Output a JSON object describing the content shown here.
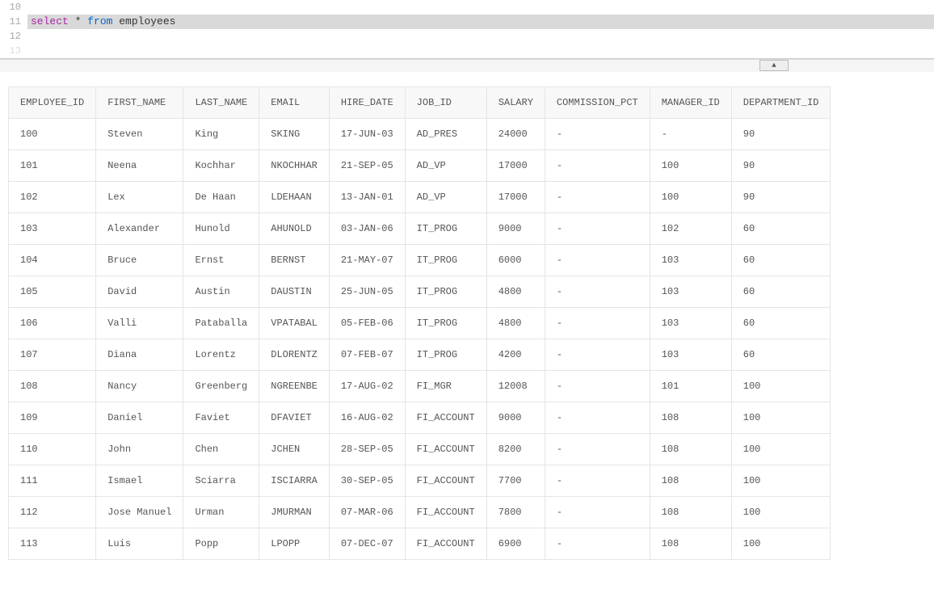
{
  "editor": {
    "lines": [
      {
        "num": "10",
        "tokens": []
      },
      {
        "num": "11",
        "tokens": [
          {
            "cls": "kw1",
            "text": "select"
          },
          {
            "cls": "",
            "text": " * "
          },
          {
            "cls": "kw2",
            "text": "from"
          },
          {
            "cls": "",
            "text": " "
          },
          {
            "cls": "ident",
            "text": "employees"
          }
        ],
        "active": true
      },
      {
        "num": "12",
        "tokens": [],
        "cursor": true
      },
      {
        "num": "13",
        "faded": true,
        "tokens": []
      }
    ],
    "scroll_arrow": "▲"
  },
  "results": {
    "columns": [
      "EMPLOYEE_ID",
      "FIRST_NAME",
      "LAST_NAME",
      "EMAIL",
      "HIRE_DATE",
      "JOB_ID",
      "SALARY",
      "COMMISSION_PCT",
      "MANAGER_ID",
      "DEPARTMENT_ID"
    ],
    "rows": [
      [
        "100",
        "Steven",
        "King",
        "SKING",
        "17-JUN-03",
        "AD_PRES",
        "24000",
        " - ",
        " - ",
        "90"
      ],
      [
        "101",
        "Neena",
        "Kochhar",
        "NKOCHHAR",
        "21-SEP-05",
        "AD_VP",
        "17000",
        " - ",
        "100",
        "90"
      ],
      [
        "102",
        "Lex",
        "De Haan",
        "LDEHAAN",
        "13-JAN-01",
        "AD_VP",
        "17000",
        " - ",
        "100",
        "90"
      ],
      [
        "103",
        "Alexander",
        "Hunold",
        "AHUNOLD",
        "03-JAN-06",
        "IT_PROG",
        "9000",
        " - ",
        "102",
        "60"
      ],
      [
        "104",
        "Bruce",
        "Ernst",
        "BERNST",
        "21-MAY-07",
        "IT_PROG",
        "6000",
        " - ",
        "103",
        "60"
      ],
      [
        "105",
        "David",
        "Austin",
        "DAUSTIN",
        "25-JUN-05",
        "IT_PROG",
        "4800",
        " - ",
        "103",
        "60"
      ],
      [
        "106",
        "Valli",
        "Pataballa",
        "VPATABAL",
        "05-FEB-06",
        "IT_PROG",
        "4800",
        " - ",
        "103",
        "60"
      ],
      [
        "107",
        "Diana",
        "Lorentz",
        "DLORENTZ",
        "07-FEB-07",
        "IT_PROG",
        "4200",
        " - ",
        "103",
        "60"
      ],
      [
        "108",
        "Nancy",
        "Greenberg",
        "NGREENBE",
        "17-AUG-02",
        "FI_MGR",
        "12008",
        " - ",
        "101",
        "100"
      ],
      [
        "109",
        "Daniel",
        "Faviet",
        "DFAVIET",
        "16-AUG-02",
        "FI_ACCOUNT",
        "9000",
        " - ",
        "108",
        "100"
      ],
      [
        "110",
        "John",
        "Chen",
        "JCHEN",
        "28-SEP-05",
        "FI_ACCOUNT",
        "8200",
        " - ",
        "108",
        "100"
      ],
      [
        "111",
        "Ismael",
        "Sciarra",
        "ISCIARRA",
        "30-SEP-05",
        "FI_ACCOUNT",
        "7700",
        " - ",
        "108",
        "100"
      ],
      [
        "112",
        "Jose Manuel",
        "Urman",
        "JMURMAN",
        "07-MAR-06",
        "FI_ACCOUNT",
        "7800",
        " - ",
        "108",
        "100"
      ],
      [
        "113",
        "Luis",
        "Popp",
        "LPOPP",
        "07-DEC-07",
        "FI_ACCOUNT",
        "6900",
        " - ",
        "108",
        "100"
      ]
    ]
  }
}
